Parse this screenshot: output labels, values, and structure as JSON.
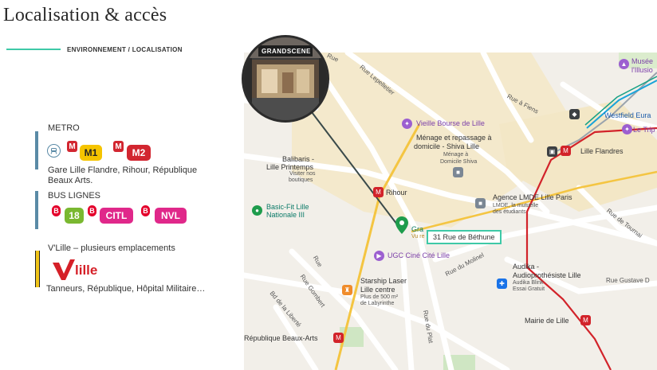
{
  "page": {
    "title": "Localisation & accès",
    "subtitle": "ENVIRONNEMENT / LOCALISATION"
  },
  "colors": {
    "accent": "#3ec9a7",
    "metro_bar": "#5a8aa6",
    "vlille_bar": "#f0c419",
    "metro_red": "#d22630",
    "m1_yellow": "#f5c400",
    "bus_18": "#7ab830",
    "bus_pink": "#e0288a"
  },
  "metro": {
    "label": "METRO",
    "lines": [
      "M1",
      "M2"
    ],
    "stations": "Gare Lille Flandre, Rihour, République Beaux Arts."
  },
  "bus": {
    "label": "BUS LIGNES",
    "lines": [
      "18",
      "CITL",
      "NVL"
    ]
  },
  "vlille": {
    "label": "V'Lille – plusieurs emplacements",
    "logo_text": "lille",
    "stations": "Tanneurs, République, Hôpital Militaire…"
  },
  "photo": {
    "sign_text": "GRANDSCENE"
  },
  "map": {
    "address": "31 Rue de Béthune",
    "places": {
      "musee": "Musée",
      "illusions": "l'Illusio",
      "vieille_bourse": "Vieille Bourse de Lille",
      "menage": "Ménage et repassage à",
      "menage2": "domicile - Shiva Lille",
      "menage3": "Ménage à",
      "menage4": "Domicile Shiva",
      "balibaris": "Balibaris -",
      "printemps": "Lille Printemps",
      "visiter": "Visiter nos",
      "boutiques": "boutiques",
      "rihour": "Rihour",
      "basic_fit": "Basic-Fit Lille",
      "nationale": "Nationale III",
      "grand": "Gra",
      "vu": "Vu re",
      "ugc": "UGC Ciné Cité Lille",
      "agence": "Agence LMDE Lille Paris",
      "lmde": "LMDE, la mutuelle",
      "etudiants": "des étudiants",
      "westfield": "Westfield Eura",
      "tripost": "Le Trip",
      "lille_flandres": "Lille Flandres",
      "starship": "Starship Laser",
      "starship2": "Lille centre",
      "starship3": "Plus de 500 m²",
      "starship4": "de Labyrinthe",
      "audika": "Audika -",
      "audika2": "Audioprothésiste Lille",
      "audika3": "Audika Blink",
      "audika4": "Essai Gratuit",
      "mairie": "Mairie de Lille",
      "republique": "République Beaux-Arts"
    },
    "streets": {
      "rue_bo": "Rue",
      "lepelletier": "Rue Lepelletier",
      "fiens": "Rue à Fiens",
      "tournai": "Rue de Tournai",
      "molinel": "Rue du Molinel",
      "gustave": "Rue Gustave D",
      "gombert": "Rue Gombert",
      "liberte": "Bd de la Liberté",
      "plat": "Rue du Plat",
      "rue": "Rue"
    }
  }
}
